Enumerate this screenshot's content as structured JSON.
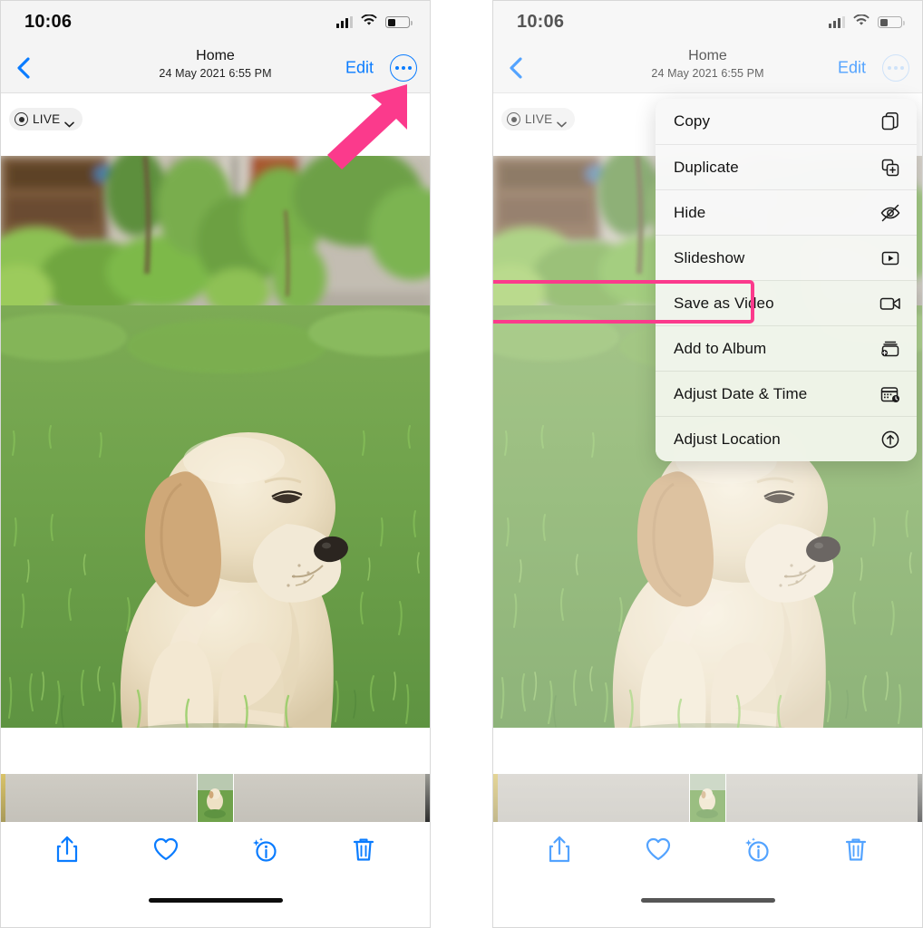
{
  "statusbar": {
    "time": "10:06",
    "signal_icon": "cellular-signal-icon",
    "wifi_icon": "wifi-icon",
    "battery_icon": "battery-icon"
  },
  "navbar": {
    "back_icon": "back-chevron-icon",
    "title": "Home",
    "subtitle": "24 May 2021  6:55 PM",
    "edit_label": "Edit",
    "more_icon": "more-options-icon"
  },
  "live_badge": {
    "icon": "live-photo-icon",
    "label": "LIVE",
    "caret_icon": "chevron-down-icon"
  },
  "photo": {
    "alt": "Labrador puppy sitting on green grass in a garden"
  },
  "toolbar": {
    "share_label": "share-icon",
    "favorite_label": "heart-icon",
    "info_label": "info-sparkle-icon",
    "delete_label": "trash-icon"
  },
  "context_menu": {
    "items": [
      {
        "label": "Copy",
        "icon": "copy-icon"
      },
      {
        "label": "Duplicate",
        "icon": "duplicate-icon"
      },
      {
        "label": "Hide",
        "icon": "eye-slash-icon"
      },
      {
        "label": "Slideshow",
        "icon": "slideshow-play-icon"
      },
      {
        "label": "Save as Video",
        "icon": "video-camera-icon"
      },
      {
        "label": "Add to Album",
        "icon": "add-to-album-icon"
      },
      {
        "label": "Adjust Date & Time",
        "icon": "calendar-clock-icon"
      },
      {
        "label": "Adjust Location",
        "icon": "location-arrow-icon"
      }
    ],
    "highlighted_item": "Save as Video"
  },
  "annotations": {
    "arrow_color": "#fb3a8c",
    "highlight_color": "#fb3a8c",
    "arrow_target": "more-options-icon"
  },
  "accent_colors": {
    "ios_blue": "#0a7cff",
    "pink": "#fb3a8c"
  }
}
